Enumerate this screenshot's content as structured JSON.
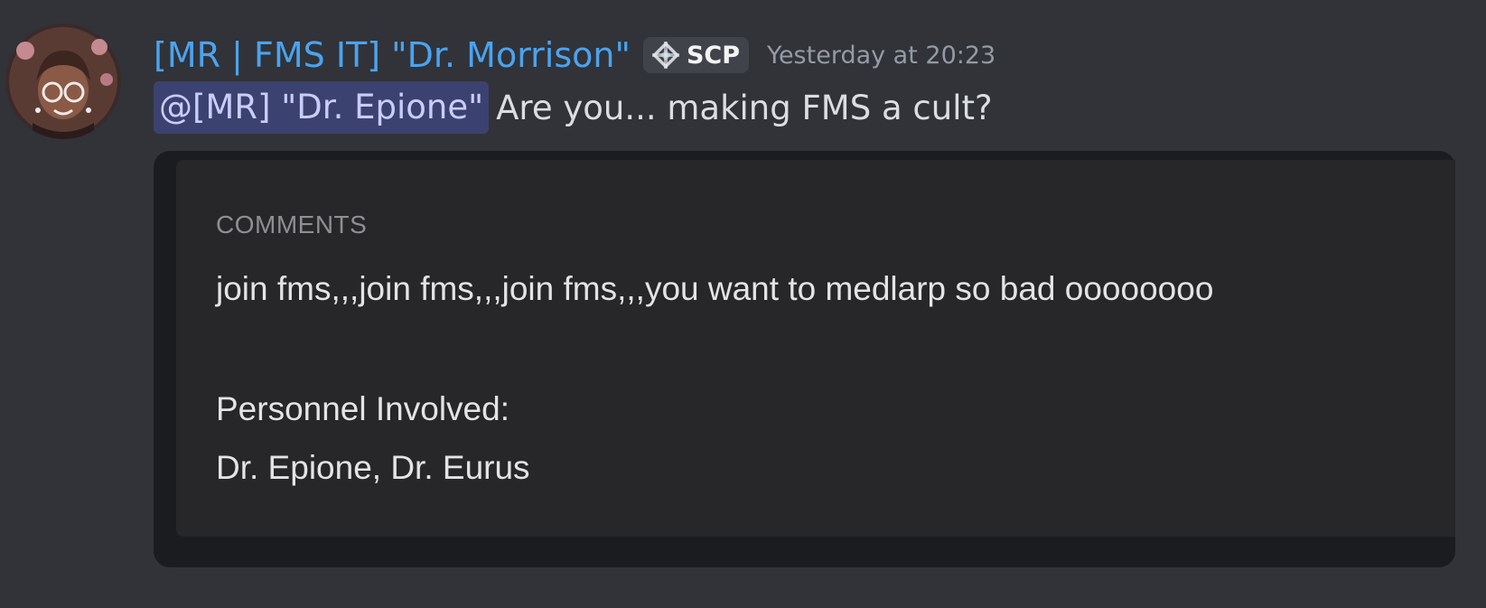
{
  "message": {
    "author": "[MR | FMS IT]  \"Dr. Morrison\"",
    "tag": {
      "label": "SCP",
      "icon": "scp-diamond-icon"
    },
    "timestamp": "Yesterday at 20:23",
    "mention": "@[MR] \"Dr. Epione\"",
    "text": "Are you... making FMS a cult?"
  },
  "attachment": {
    "heading": "COMMENTS",
    "line1": "join fms,,,join fms,,,join fms,,,you want to medlarp so bad oooooooo",
    "line2": "Personnel Involved:",
    "line3": "Dr. Epione, Dr. Eurus"
  },
  "colors": {
    "background": "#313338",
    "author": "#4ba3ef",
    "mention_bg": "#3c4270",
    "mention_text": "#c9cdfb",
    "timestamp": "#949ba4"
  }
}
